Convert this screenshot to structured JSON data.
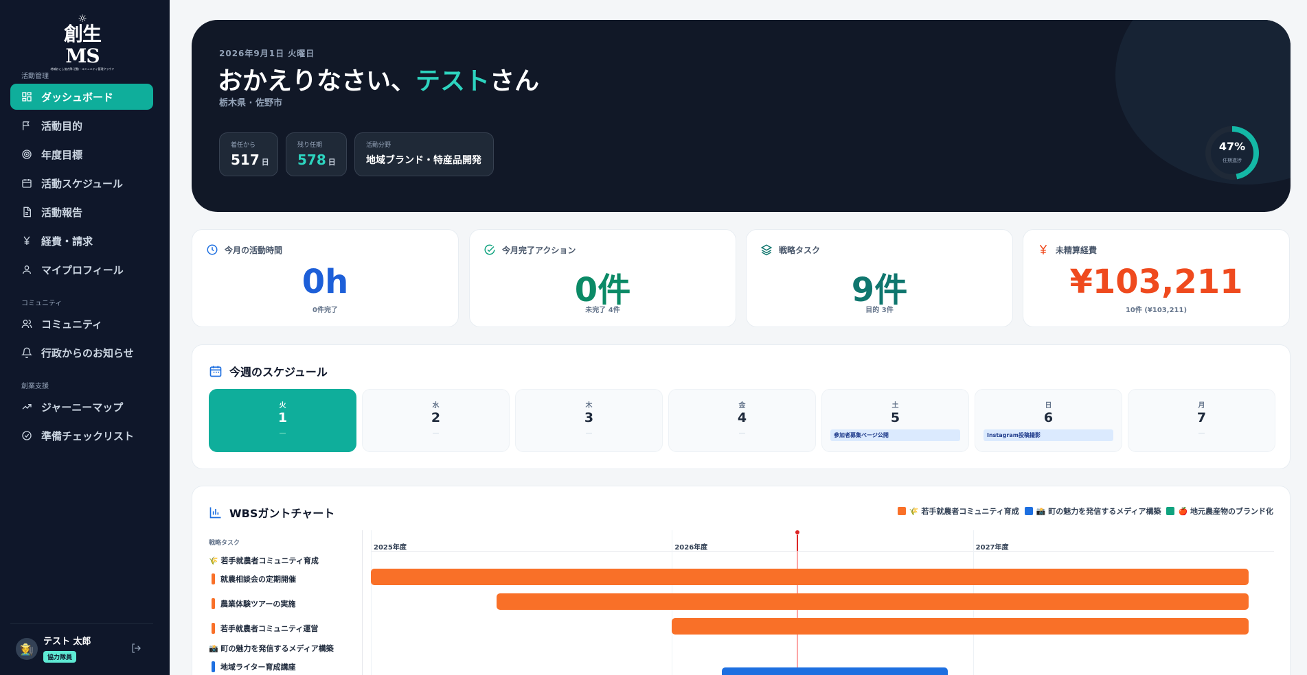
{
  "sidebar": {
    "logo": {
      "name": "創生MS",
      "tagline": "地域おこし協力隊 活動・コミュニティ管理クラウド"
    },
    "sections": {
      "activity": "活動管理",
      "community": "コミュニティ",
      "startup": "創業支援"
    },
    "items": [
      {
        "label": "ダッシュボード",
        "icon": "dashboard-icon",
        "active": true
      },
      {
        "label": "活動目的",
        "icon": "flag-icon"
      },
      {
        "label": "年度目標",
        "icon": "target-icon"
      },
      {
        "label": "活動スケジュール",
        "icon": "calendar-icon"
      },
      {
        "label": "活動報告",
        "icon": "document-icon"
      },
      {
        "label": "経費・請求",
        "icon": "yen-icon"
      },
      {
        "label": "マイプロフィール",
        "icon": "user-icon"
      },
      {
        "label": "コミュニティ",
        "icon": "users-icon"
      },
      {
        "label": "行政からのお知らせ",
        "icon": "bell-icon"
      },
      {
        "label": "ジャーニーマップ",
        "icon": "trending-up-icon"
      },
      {
        "label": "準備チェックリスト",
        "icon": "check-circle-icon"
      }
    ],
    "user": {
      "name": "テスト 太郎",
      "role": "協力隊員",
      "avatar_icon": "🧑‍🌾"
    }
  },
  "hero": {
    "date": "2026年9月1日  火曜日",
    "greeting_prefix": "おかえりなさい、",
    "greeting_name": "テスト",
    "greeting_suffix": "さん",
    "location": "栃木県 · 佐野市",
    "chips": [
      {
        "label": "着任から",
        "value": "517",
        "unit": "日"
      },
      {
        "label": "残り任期",
        "value": "578",
        "unit": "日"
      },
      {
        "label": "活動分野",
        "value": "地域ブランド・特産品開発"
      }
    ],
    "progress": {
      "value": "47%",
      "fraction": 0.47,
      "label": "任期進捗"
    }
  },
  "stats": [
    {
      "title": "今月の活動時間",
      "value": "0h",
      "sub": "0件完了",
      "color": "#1d5fd8",
      "icon": "clock-icon"
    },
    {
      "title": "今月完了アクション",
      "value": "0件",
      "sub": "未完了 4件",
      "color": "#0b8a66",
      "icon": "check-circle-icon"
    },
    {
      "title": "戦略タスク",
      "value": "9件",
      "sub": "目的 3件",
      "color": "#0f766e",
      "icon": "layers-icon"
    },
    {
      "title": "未精算経費",
      "value": "¥103,211",
      "sub": "10件 (¥103,211)",
      "color": "#ef4a1e",
      "icon": "yen-icon"
    }
  ],
  "week": {
    "title": "今週のスケジュール",
    "days": [
      {
        "dow": "火",
        "date": "1",
        "empty": "—",
        "today": true
      },
      {
        "dow": "水",
        "date": "2",
        "empty": "—"
      },
      {
        "dow": "木",
        "date": "3",
        "empty": "—"
      },
      {
        "dow": "金",
        "date": "4",
        "empty": "—"
      },
      {
        "dow": "土",
        "date": "5",
        "event": "参加者募集ページ公開"
      },
      {
        "dow": "日",
        "date": "6",
        "event": "Instagram投稿撮影"
      },
      {
        "dow": "月",
        "date": "7",
        "empty": "—"
      }
    ]
  },
  "gantt": {
    "title": "WBSガントチャート",
    "header": "戦略タスク",
    "legend": [
      {
        "label": "🌾 若手就農者コミュニティ育成",
        "color": "#f97028"
      },
      {
        "label": "📸 町の魅力を発信するメディア構築",
        "color": "#1d6fe0"
      },
      {
        "label": "🍎 地元農産物のブランド化",
        "color": "#10a37f"
      }
    ],
    "years": [
      "2025年度",
      "2026年度",
      "2027年度"
    ],
    "groups": [
      {
        "label": "🌾 若手就農者コミュニティ育成",
        "color": "#f97028",
        "tasks": [
          {
            "label": "就農相談会の定期開催",
            "start": "2025-04",
            "end": "2028-03"
          },
          {
            "label": "農業体験ツアーの実施",
            "start": "2025-09",
            "end": "2028-03"
          },
          {
            "label": "若手就農者コミュニティ運営",
            "start": "2026-04",
            "end": "2028-03"
          }
        ]
      },
      {
        "label": "📸 町の魅力を発信するメディア構築",
        "color": "#1d6fe0",
        "tasks": [
          {
            "label": "地域ライター育成講座",
            "start": "2026-06",
            "end": "2027-03"
          }
        ]
      }
    ],
    "today": "2026-09"
  }
}
